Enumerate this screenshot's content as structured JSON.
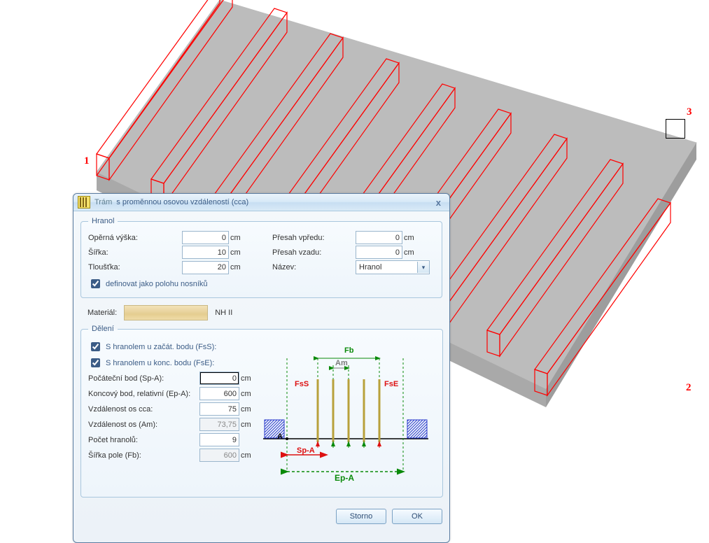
{
  "markers": {
    "p1": "1",
    "p2": "2",
    "p3": "3"
  },
  "dialog": {
    "title_main": "Trám",
    "title_sub": "s proměnnou osovou vzdáleností (cca)",
    "close_x": "x"
  },
  "hranol": {
    "legend": "Hranol",
    "operna_vyska_label": "Opěrná výška:",
    "operna_vyska": "0",
    "sirka_label": "Šířka:",
    "sirka": "10",
    "tloustka_label": "Tloušťka:",
    "tloustka": "20",
    "presah_vpredu_label": "Přesah vpředu:",
    "presah_vpredu": "0",
    "presah_vzadu_label": "Přesah vzadu:",
    "presah_vzadu": "0",
    "nazev_label": "Název:",
    "nazev_value": "Hranol",
    "unit_cm": "cm",
    "def_nosniku_label": "definovat jako polohu nosníků",
    "def_nosniku_checked": true
  },
  "material": {
    "label": "Materiál:",
    "code": "NH II"
  },
  "deleni": {
    "legend": "Dělení",
    "fs_start_label": "S hranolem u začát. bodu (FsS):",
    "fs_start_checked": true,
    "fs_end_label": "S hranolem u konc. bodu (FsE):",
    "fs_end_checked": true,
    "sp_a_label": "Počáteční bod  (Sp-A):",
    "sp_a": "0",
    "ep_a_label": "Koncový bod, relativní  (Ep-A):",
    "ep_a": "600",
    "vzd_cca_label": "Vzdálenost os cca:",
    "vzd_cca": "75",
    "am_label": "Vzdálenost os (Am):",
    "am": "73,75",
    "pocet_label": "Počet hranolů:",
    "pocet": "9",
    "fb_label": "Šířka pole (Fb):",
    "fb": "600",
    "unit_cm": "cm"
  },
  "schem": {
    "Fb": "Fb",
    "Am": "Am",
    "FsS": "FsS",
    "FsE": "FsE",
    "SpA": "Sp-A",
    "EpA": "Ep-A",
    "A": "A"
  },
  "buttons": {
    "storno": "Storno",
    "ok": "OK"
  }
}
